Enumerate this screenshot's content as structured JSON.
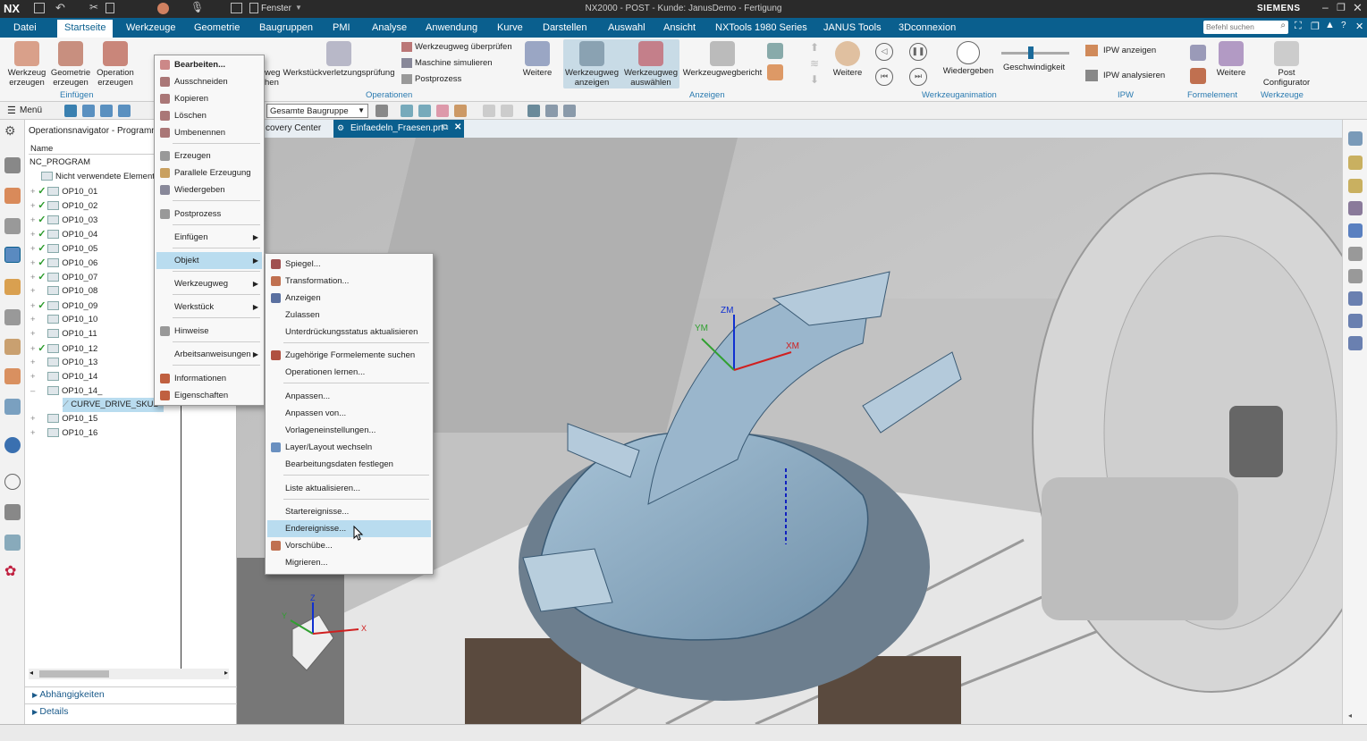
{
  "window": {
    "app_logo": "NX",
    "title": "NX2000 - POST - Kunde: JanusDemo - Fertigung",
    "fenster": "Fenster",
    "brand": "SIEMENS",
    "search_placeholder": "Befehl suchen"
  },
  "menubar": [
    "Datei",
    "Startseite",
    "Werkzeuge",
    "Geometrie",
    "Baugruppen",
    "PMI",
    "Analyse",
    "Anwendung",
    "Kurve",
    "Darstellen",
    "Auswahl",
    "Ansicht",
    "NXTools 1980 Series",
    "JANUS Tools",
    "3Dconnexion"
  ],
  "ribbon": {
    "werkzeug_erzeugen": "Werkzeug erzeugen",
    "geometrie_erzeugen": "Geometrie erzeugen",
    "operation_erzeugen": "Operation erzeugen",
    "group_einfuegen": "Einfügen",
    "weg": "weg",
    "hen": "hen",
    "werkstueckverletzung": "Werkstückverletzungsprüfung",
    "pruefen": "Werkzeugweg überprüfen",
    "simulieren": "Maschine simulieren",
    "postprozess": "Postprozess",
    "weitere": "Weitere",
    "group_operationen": "Operationen",
    "weg_anzeigen": "Werkzeugweg anzeigen",
    "weg_auswaehlen": "Werkzeugweg auswählen",
    "weg_bericht": "Werkzeugwegbericht",
    "group_anzeigen": "Anzeigen",
    "wiedergeben": "Wiedergeben",
    "geschwindigkeit": "Geschwindigkeit",
    "group_animation": "Werkzeuganimation",
    "ipw_anzeigen": "IPW anzeigen",
    "ipw_analysieren": "IPW analysieren",
    "group_ipw": "IPW",
    "group_formelement": "Formelement",
    "post_configurator": "Post Configurator",
    "group_werkzeuge": "Werkzeuge"
  },
  "quickbar": {
    "menu": "Menü",
    "assembly": "Gesamte Baugruppe"
  },
  "tabs": {
    "discovery": "covery Center",
    "file": "Einfaedeln_Fraesen.prt"
  },
  "navigator": {
    "title": "Operationsnavigator - Programm",
    "column_name": "Name",
    "root": "NC_PROGRAM",
    "unused": "Nicht verwendete Element",
    "ops": [
      {
        "n": "OP10_01",
        "c": true
      },
      {
        "n": "OP10_02",
        "c": true
      },
      {
        "n": "OP10_03",
        "c": true
      },
      {
        "n": "OP10_04",
        "c": true
      },
      {
        "n": "OP10_05",
        "c": true
      },
      {
        "n": "OP10_06",
        "c": true
      },
      {
        "n": "OP10_07",
        "c": true
      },
      {
        "n": "OP10_08",
        "c": false
      },
      {
        "n": "OP10_09",
        "c": true
      },
      {
        "n": "OP10_10",
        "c": false
      },
      {
        "n": "OP10_11",
        "c": false
      },
      {
        "n": "OP10_12",
        "c": true
      },
      {
        "n": "OP10_13",
        "c": false
      },
      {
        "n": "OP10_14",
        "c": false
      },
      {
        "n": "OP10_14_",
        "c": false
      }
    ],
    "child": "CURVE_DRIVE_SKUL",
    "ops2": [
      "OP10_15",
      "OP10_16"
    ],
    "abhaengigkeiten": "Abhängigkeiten",
    "details": "Details"
  },
  "context_menu": [
    "Bearbeiten...",
    "Ausschneiden",
    "Kopieren",
    "Löschen",
    "Umbenennen",
    "Erzeugen",
    "Parallele Erzeugung",
    "Wiedergeben",
    "Postprozess",
    "Einfügen",
    "Objekt",
    "Werkzeugweg",
    "Werkstück",
    "Hinweise",
    "Arbeitsanweisungen",
    "Informationen",
    "Eigenschaften"
  ],
  "submenu": [
    "Spiegel...",
    "Transformation...",
    "Anzeigen",
    "Zulassen",
    "Unterdrückungsstatus aktualisieren",
    "Zugehörige Formelemente suchen",
    "Operationen lernen...",
    "Anpassen...",
    "Anpassen von...",
    "Vorlageneinstellungen...",
    "Layer/Layout wechseln",
    "Bearbeitungsdaten festlegen",
    "Liste aktualisieren...",
    "Startereignisse...",
    "Endereignisse...",
    "Vorschübe...",
    "Migrieren..."
  ],
  "viewport": {
    "zm": "ZM",
    "ym": "YM",
    "xm": "XM",
    "z": "Z",
    "y": "Y",
    "x": "X"
  }
}
